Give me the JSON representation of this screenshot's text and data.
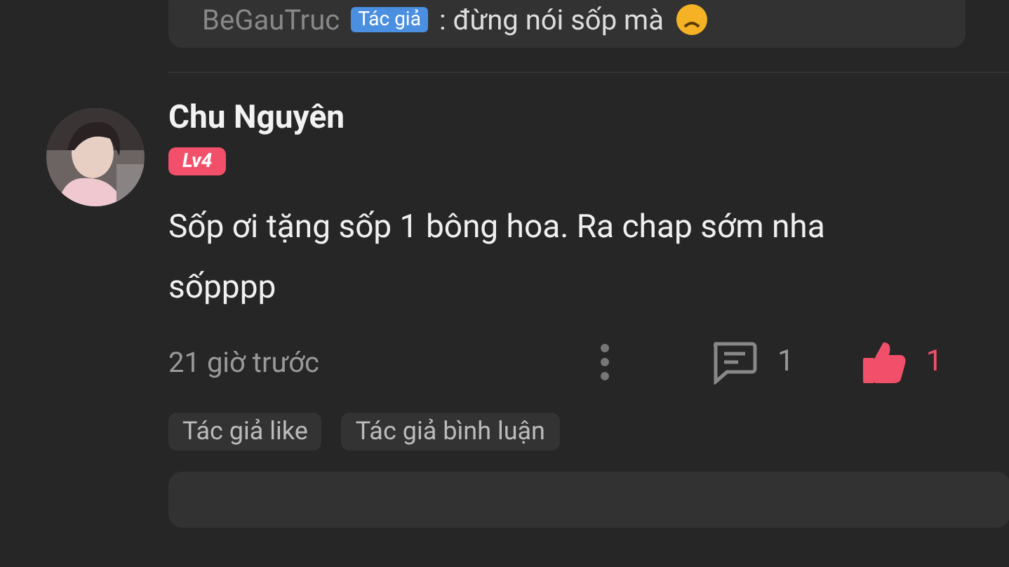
{
  "previous_reply": {
    "author": "BeGauTruc",
    "badge": "Tác giả",
    "text": ": đừng nói sốp mà"
  },
  "comment": {
    "author": "Chu Nguyên",
    "level_badge": "Lv4",
    "text": "Sốp ơi tặng sốp 1 bông hoa. Ra chap sớm nha sốpppp",
    "time": "21 giờ trước",
    "reply_count": "1",
    "like_count": "1",
    "liked": true,
    "tags": [
      "Tác giả like",
      "Tác giả bình luận"
    ]
  }
}
